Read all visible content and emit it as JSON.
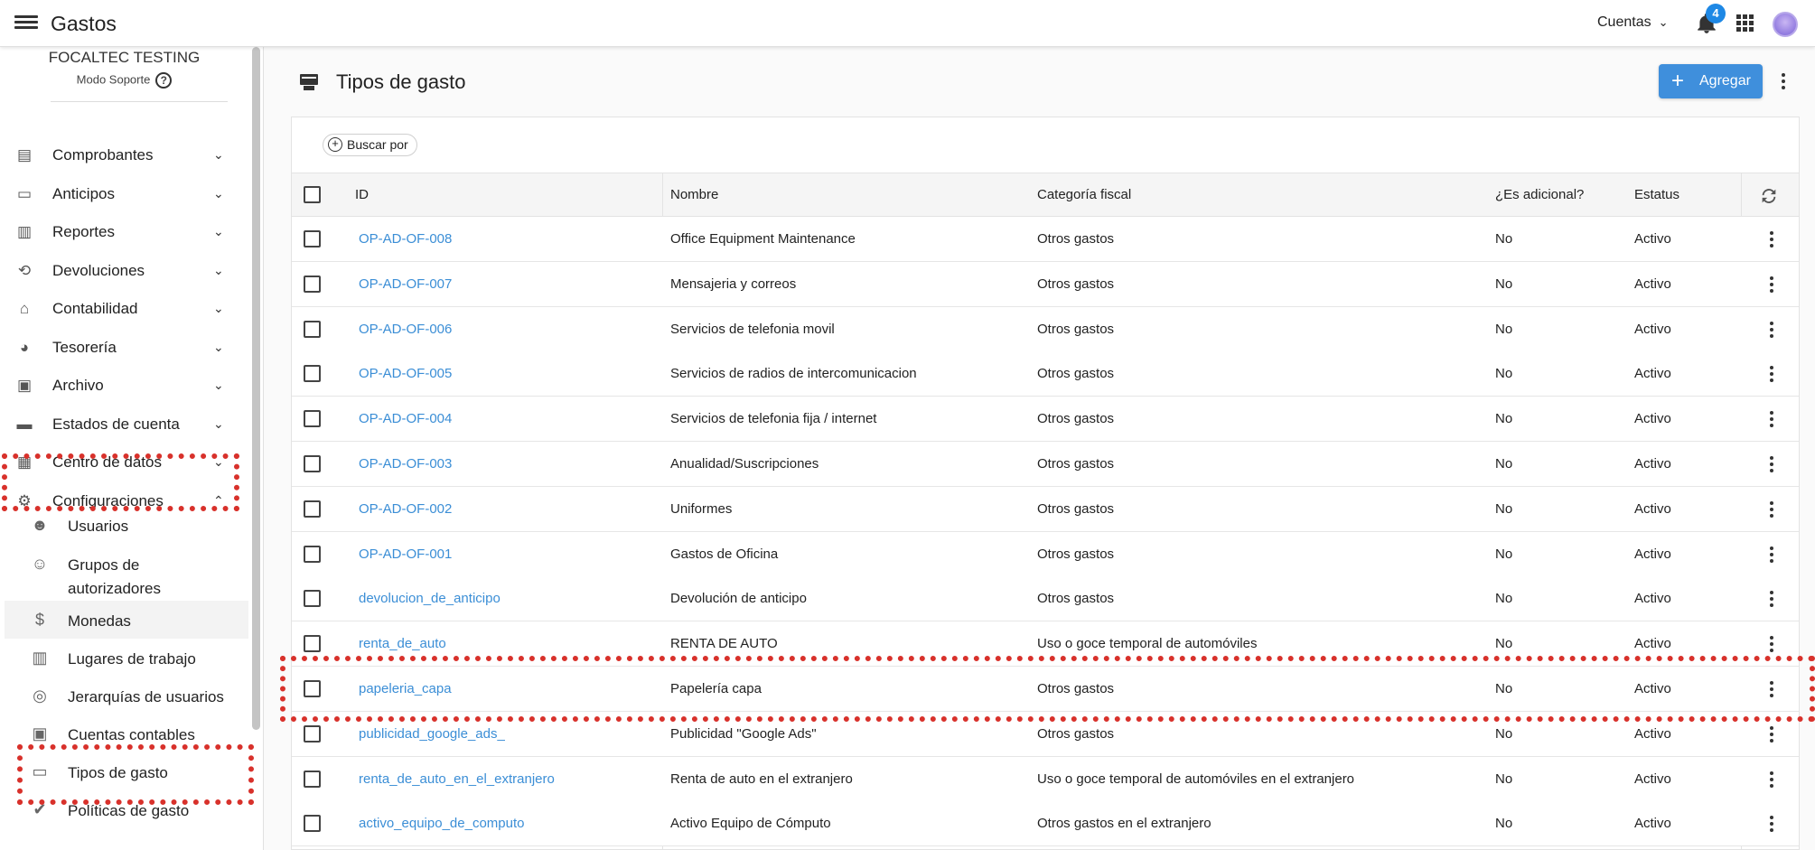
{
  "header": {
    "app_title": "Gastos",
    "cuentas_label": "Cuentas",
    "notification_count": "4",
    "icons": {
      "menu": "hamburger-icon",
      "bell": "bell-icon",
      "apps": "grid-icon",
      "avatar": "avatar-icon"
    }
  },
  "sidebar": {
    "company": "FOCALTEC TESTING",
    "support_mode": "Modo Soporte",
    "items": [
      {
        "label": "Comprobantes",
        "icon": "document-icon",
        "glyph": "▤",
        "expanded": false
      },
      {
        "label": "Anticipos",
        "icon": "cash-icon",
        "glyph": "▭",
        "expanded": false
      },
      {
        "label": "Reportes",
        "icon": "report-icon",
        "glyph": "▥",
        "expanded": false
      },
      {
        "label": "Devoluciones",
        "icon": "refund-icon",
        "glyph": "⟲",
        "expanded": false
      },
      {
        "label": "Contabilidad",
        "icon": "bank-icon",
        "glyph": "⌂",
        "expanded": false
      },
      {
        "label": "Tesorería",
        "icon": "piggy-bank-icon",
        "glyph": "◕",
        "expanded": false
      },
      {
        "label": "Archivo",
        "icon": "archive-icon",
        "glyph": "▣",
        "expanded": false
      },
      {
        "label": "Estados de cuenta",
        "icon": "wallet-icon",
        "glyph": "▬",
        "expanded": false
      },
      {
        "label": "Centro de datos",
        "icon": "database-icon",
        "glyph": "▦",
        "expanded": false
      },
      {
        "label": "Configuraciones",
        "icon": "gear-icon",
        "glyph": "⚙",
        "expanded": true
      }
    ],
    "sub_items": [
      {
        "label": "Usuarios",
        "icon": "users-icon",
        "glyph": "☻"
      },
      {
        "label": "Grupos de autorizadores",
        "icon": "group-icon",
        "glyph": "☺"
      },
      {
        "label": "Monedas",
        "icon": "dollar-icon",
        "glyph": "$",
        "active": true
      },
      {
        "label": "Lugares de trabajo",
        "icon": "building-icon",
        "glyph": "▥"
      },
      {
        "label": "Jerarquías de usuarios",
        "icon": "hierarchy-icon",
        "glyph": "◎"
      },
      {
        "label": "Cuentas contables",
        "icon": "ledger-icon",
        "glyph": "▣"
      },
      {
        "label": "Tipos de gasto",
        "icon": "expense-type-icon",
        "glyph": "▭"
      },
      {
        "label": "Políticas de gasto",
        "icon": "policy-icon",
        "glyph": "✔"
      }
    ]
  },
  "main": {
    "title": "Tipos de gasto",
    "add_label": "Agregar",
    "search_by": "Buscar por",
    "columns": {
      "id": "ID",
      "name": "Nombre",
      "category": "Categoría fiscal",
      "additional": "¿Es adicional?",
      "status": "Estatus"
    },
    "rows": [
      {
        "id": "OP-AD-OF-008",
        "name": "Office Equipment Maintenance",
        "category": "Otros gastos",
        "additional": "No",
        "status": "Activo"
      },
      {
        "id": "OP-AD-OF-007",
        "name": "Mensajeria y correos",
        "category": "Otros gastos",
        "additional": "No",
        "status": "Activo"
      },
      {
        "id": "OP-AD-OF-006",
        "name": "Servicios de telefonia movil",
        "category": "Otros gastos",
        "additional": "No",
        "status": "Activo"
      },
      {
        "id": "OP-AD-OF-005",
        "name": "Servicios de radios de intercomunicacion",
        "category": "Otros gastos",
        "additional": "No",
        "status": "Activo"
      },
      {
        "id": "OP-AD-OF-004",
        "name": "Servicios de telefonia fija / internet",
        "category": "Otros gastos",
        "additional": "No",
        "status": "Activo"
      },
      {
        "id": "OP-AD-OF-003",
        "name": "Anualidad/Suscripciones",
        "category": "Otros gastos",
        "additional": "No",
        "status": "Activo"
      },
      {
        "id": "OP-AD-OF-002",
        "name": "Uniformes",
        "category": "Otros gastos",
        "additional": "No",
        "status": "Activo"
      },
      {
        "id": "OP-AD-OF-001",
        "name": "Gastos de Oficina",
        "category": "Otros gastos",
        "additional": "No",
        "status": "Activo"
      },
      {
        "id": "devolucion_de_anticipo",
        "name": "Devolución de anticipo",
        "category": "Otros gastos",
        "additional": "No",
        "status": "Activo"
      },
      {
        "id": "renta_de_auto",
        "name": "RENTA DE AUTO",
        "category": "Uso o goce temporal de automóviles",
        "additional": "No",
        "status": "Activo"
      },
      {
        "id": "papeleria_capa",
        "name": "Papelería capa",
        "category": "Otros gastos",
        "additional": "No",
        "status": "Activo"
      },
      {
        "id": "publicidad_google_ads_",
        "name": "Publicidad \"Google Ads\"",
        "category": "Otros gastos",
        "additional": "No",
        "status": "Activo"
      },
      {
        "id": "renta_de_auto_en_el_extranjero",
        "name": "Renta de auto en el extranjero",
        "category": "Uso o goce temporal de automóviles en el extranjero",
        "additional": "No",
        "status": "Activo"
      },
      {
        "id": "activo_equipo_de_computo",
        "name": "Activo Equipo de Cómputo",
        "category": "Otros gastos en el extranjero",
        "additional": "No",
        "status": "Activo"
      }
    ]
  },
  "colors": {
    "accent": "#3f8fdc",
    "link": "#3b8ed6",
    "highlight": "#d8312b",
    "badge": "#1e88e5"
  }
}
